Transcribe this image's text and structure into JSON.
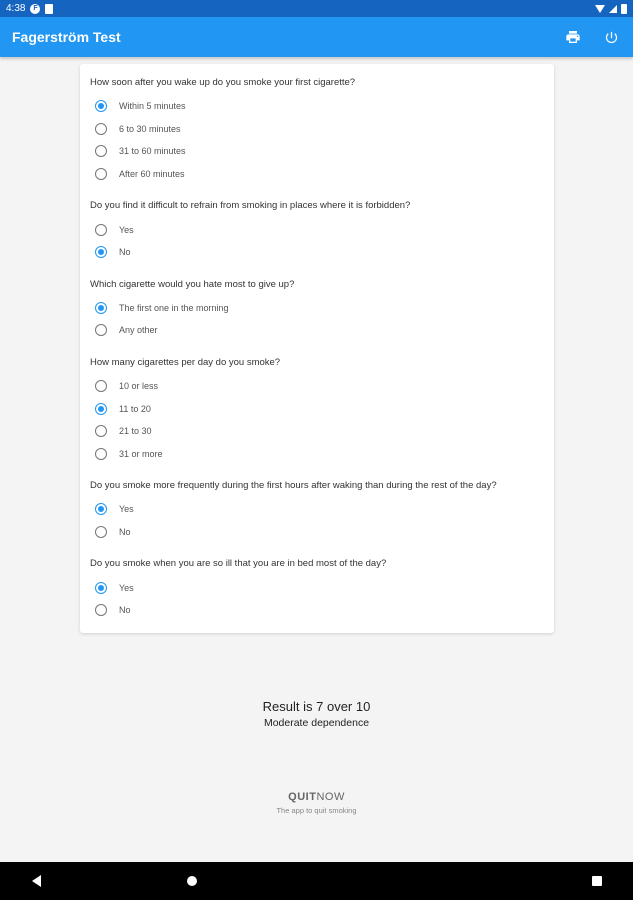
{
  "status_bar": {
    "time": "4:38",
    "icons": [
      "app-notification-icon",
      "document-icon",
      "wifi-icon",
      "cell-signal-icon",
      "battery-icon"
    ]
  },
  "app_bar": {
    "title": "Fagerström Test",
    "actions": [
      "print-icon",
      "reset-icon"
    ],
    "color": "#2196f3"
  },
  "questions": [
    {
      "text": "How soon after you wake up do you smoke your first cigarette?",
      "options": [
        {
          "label": "Within 5 minutes",
          "selected": true
        },
        {
          "label": "6 to 30 minutes",
          "selected": false
        },
        {
          "label": "31 to 60 minutes",
          "selected": false
        },
        {
          "label": "After 60 minutes",
          "selected": false
        }
      ]
    },
    {
      "text": "Do you find it difficult to refrain from smoking in places where it is forbidden?",
      "options": [
        {
          "label": "Yes",
          "selected": false
        },
        {
          "label": "No",
          "selected": true
        }
      ]
    },
    {
      "text": "Which cigarette would you hate most to give up?",
      "options": [
        {
          "label": "The first one in the morning",
          "selected": true
        },
        {
          "label": "Any other",
          "selected": false
        }
      ]
    },
    {
      "text": "How many cigarettes per day do you smoke?",
      "options": [
        {
          "label": "10 or less",
          "selected": false
        },
        {
          "label": "11 to 20",
          "selected": true
        },
        {
          "label": "21 to 30",
          "selected": false
        },
        {
          "label": "31 or more",
          "selected": false
        }
      ]
    },
    {
      "text": "Do you smoke more frequently during the first hours after waking than during the rest of the day?",
      "options": [
        {
          "label": "Yes",
          "selected": true
        },
        {
          "label": "No",
          "selected": false
        }
      ]
    },
    {
      "text": "Do you smoke when you are so ill that you are in bed most of the day?",
      "options": [
        {
          "label": "Yes",
          "selected": true
        },
        {
          "label": "No",
          "selected": false
        }
      ]
    }
  ],
  "result": {
    "score_text": "Result is 7 over 10",
    "level_text": "Moderate dependence"
  },
  "brand": {
    "logo_bold": "QUIT",
    "logo_light": "NOW",
    "tagline": "The app to quit smoking"
  },
  "nav_bar": {
    "buttons": [
      "back-icon",
      "home-icon",
      "recent-apps-icon"
    ]
  },
  "colors": {
    "status_bar": "#1565c0",
    "accent": "#2196f3",
    "background": "#f4f4f4"
  }
}
